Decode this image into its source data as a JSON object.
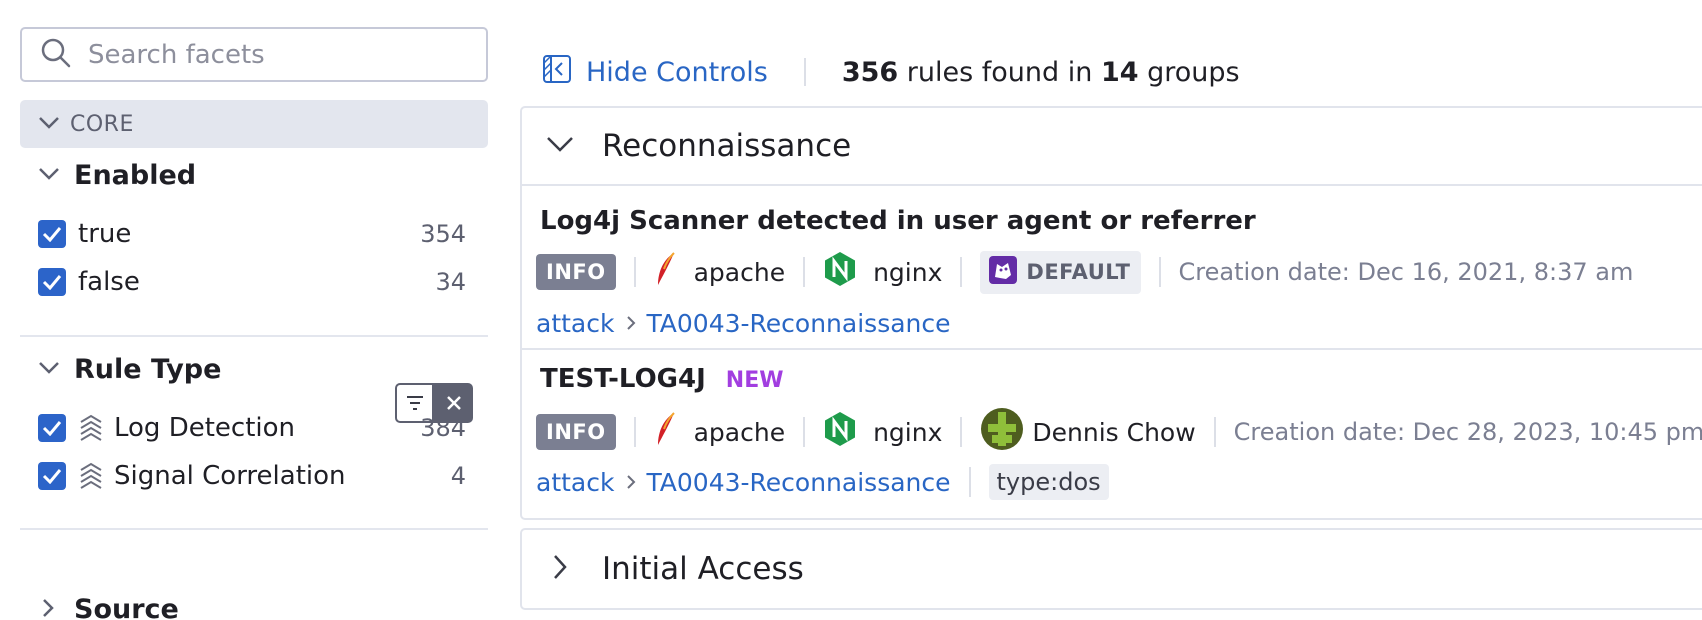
{
  "facets": {
    "search": {
      "placeholder": "Search facets",
      "value": ""
    },
    "core_label": "CORE",
    "enabled": {
      "title": "Enabled",
      "items": [
        {
          "label": "true",
          "count": "354",
          "checked": true
        },
        {
          "label": "false",
          "count": "34",
          "checked": true
        }
      ]
    },
    "rule_type": {
      "title": "Rule Type",
      "items": [
        {
          "label": "Log Detection",
          "count": "384",
          "checked": true
        },
        {
          "label": "Signal Correlation",
          "count": "4",
          "checked": true
        }
      ]
    },
    "source": {
      "title": "Source"
    }
  },
  "main": {
    "hide_controls_label": "Hide Controls",
    "summary": {
      "rules_count": "356",
      "text_mid": "rules found in",
      "groups_count": "14",
      "text_end": "groups"
    },
    "groups": [
      {
        "title": "Reconnaissance",
        "expanded": true,
        "rules": [
          {
            "title": "Log4j Scanner detected in user agent or referrer",
            "badge": "",
            "severity": "INFO",
            "sources": [
              "apache",
              "nginx"
            ],
            "default_label": "DEFAULT",
            "creation_date": "Creation date: Dec 16, 2021, 8:37 am",
            "tactic_root": "attack",
            "tactic": "TA0043-Reconnaissance"
          },
          {
            "title": "TEST-LOG4J",
            "badge": "NEW",
            "severity": "INFO",
            "sources": [
              "apache",
              "nginx"
            ],
            "author": "Dennis Chow",
            "creation_date": "Creation date: Dec 28, 2023, 10:45 pm",
            "tactic_root": "attack",
            "tactic": "TA0043-Reconnaissance",
            "tag_key": "type:",
            "tag_value": "dos"
          }
        ]
      },
      {
        "title": "Initial Access",
        "expanded": false
      }
    ]
  },
  "colors": {
    "accent": "#2c64c9",
    "link": "#2966c4",
    "new_badge": "#a23ee0",
    "severity_info": "#7b7f92",
    "nginx_green": "#1e9b4b",
    "apache_red": "#d22128",
    "datadog_purple": "#632ca6"
  },
  "icons": {
    "search": "search-icon",
    "chevron_down": "chevron-down-icon",
    "chevron_right": "chevron-right-icon",
    "check": "check-icon",
    "log_detection": "log-detection-icon",
    "signal_correlation": "signal-correlation-icon",
    "filter": "filter-icon",
    "close": "close-icon",
    "hide_controls": "hide-controls-icon",
    "apache": "apache-feather-icon",
    "nginx": "nginx-icon",
    "datadog": "datadog-dog-icon",
    "avatar": "avatar-icon"
  }
}
